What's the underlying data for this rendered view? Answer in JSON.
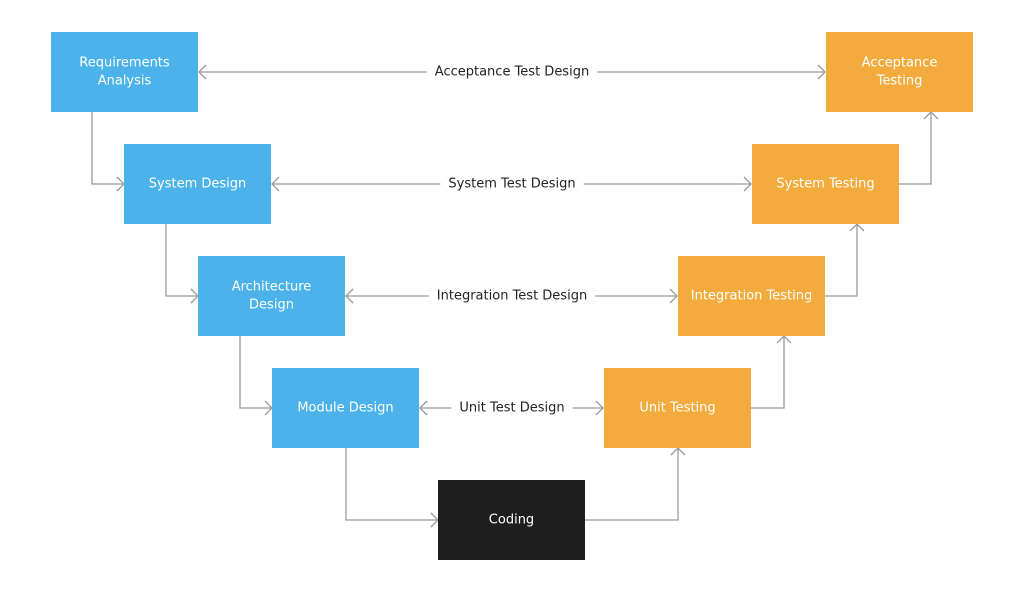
{
  "colors": {
    "design": "#4bb3ea",
    "testing": "#f3ab3d",
    "coding": "#1f1f1f",
    "connector": "#9a9a9a"
  },
  "design_boxes": [
    {
      "lines": [
        "Requirements",
        "Analysis"
      ]
    },
    {
      "lines": [
        "System Design"
      ]
    },
    {
      "lines": [
        "Architecture",
        "Design"
      ]
    },
    {
      "lines": [
        "Module Design"
      ]
    }
  ],
  "testing_boxes": [
    {
      "lines": [
        "Acceptance",
        "Testing"
      ]
    },
    {
      "lines": [
        "System Testing"
      ]
    },
    {
      "lines": [
        "Integration Testing"
      ]
    },
    {
      "lines": [
        "Unit Testing"
      ]
    }
  ],
  "coding_box": {
    "lines": [
      "Coding"
    ]
  },
  "test_design_links": [
    "Acceptance Test Design",
    "System Test Design",
    "Integration Test Design",
    "Unit Test Design"
  ]
}
